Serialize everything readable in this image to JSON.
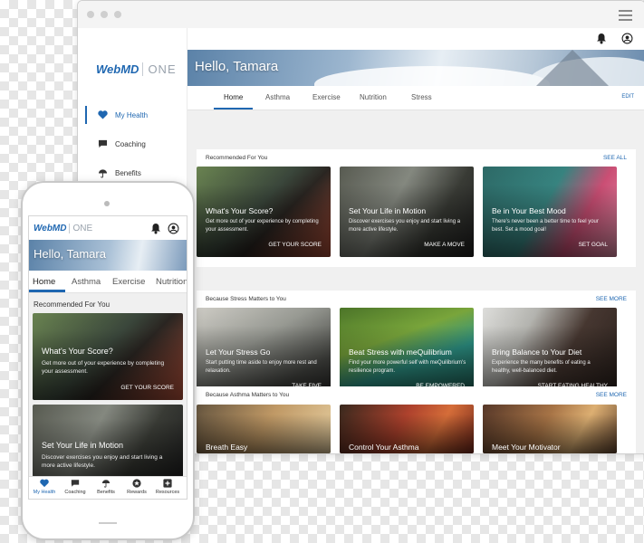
{
  "brand": {
    "logo": "WebMD",
    "suffix": "ONE",
    "color": "#1f67b1"
  },
  "sidebar": {
    "items": [
      {
        "label": "My Health",
        "icon": "heart-icon"
      },
      {
        "label": "Coaching",
        "icon": "chat-icon"
      },
      {
        "label": "Benefits",
        "icon": "umbrella-icon"
      }
    ]
  },
  "header": {
    "greeting": "Hello, Tamara",
    "icons": [
      "bell-icon",
      "user-icon"
    ]
  },
  "tabs": {
    "items": [
      "Home",
      "Asthma",
      "Exercise",
      "Nutrition",
      "Stress"
    ],
    "edit_label": "EDIT"
  },
  "sections": [
    {
      "title": "Recommended For You",
      "see_label": "SEE ALL",
      "cards": [
        {
          "title": "What's Your Score?",
          "description": "Get more out of your experience by completing your assessment.",
          "cta": "GET YOUR SCORE"
        },
        {
          "title": "Set Your Life in Motion",
          "description": "Discover exercises you enjoy and start living a more active lifestyle.",
          "cta": "MAKE A MOVE"
        },
        {
          "title": "Be in Your Best Mood",
          "description": "There's never been a better time to feel your best. Set a mood goal!",
          "cta": "SET GOAL"
        }
      ]
    },
    {
      "title": "Because Stress Matters to You",
      "see_label": "SEE MORE",
      "cards": [
        {
          "title": "Let Your Stress Go",
          "description": "Start putting time aside to enjoy more rest and relaxation.",
          "cta": "TAKE FIVE"
        },
        {
          "title": "Beat Stress with meQuilibrium",
          "description": "Find your more powerful self with meQuilibrium's resilience program.",
          "cta": "BE EMPOWERED"
        },
        {
          "title": "Bring Balance to Your Diet",
          "description": "Experience the many benefits of eating a healthy, well-balanced diet.",
          "cta": "START EATING HEALTHY"
        }
      ]
    },
    {
      "title": "Because Asthma Matters to You",
      "see_label": "SEE MORE",
      "cards": [
        {
          "title": "Breath Easy"
        },
        {
          "title": "Control Your Asthma"
        },
        {
          "title": "Meet Your Motivator"
        }
      ]
    }
  ],
  "mobile": {
    "tabs": [
      "Home",
      "Asthma",
      "Exercise",
      "Nutrition"
    ],
    "section_title": "Recommended For You",
    "cards": [
      {
        "title": "What's Your Score?",
        "description": "Get more out of your experience by completing your assessment.",
        "cta": "GET YOUR SCORE"
      },
      {
        "title": "Set Your Life in Motion",
        "description": "Discover exercises you enjoy and start living a more active lifestyle."
      }
    ],
    "bottom_nav": [
      {
        "label": "My Health",
        "icon": "heart-icon"
      },
      {
        "label": "Coaching",
        "icon": "chat-icon"
      },
      {
        "label": "Benefits",
        "icon": "umbrella-icon"
      },
      {
        "label": "Rewards",
        "icon": "star-badge-icon"
      },
      {
        "label": "Resources",
        "icon": "plus-box-icon"
      }
    ]
  }
}
